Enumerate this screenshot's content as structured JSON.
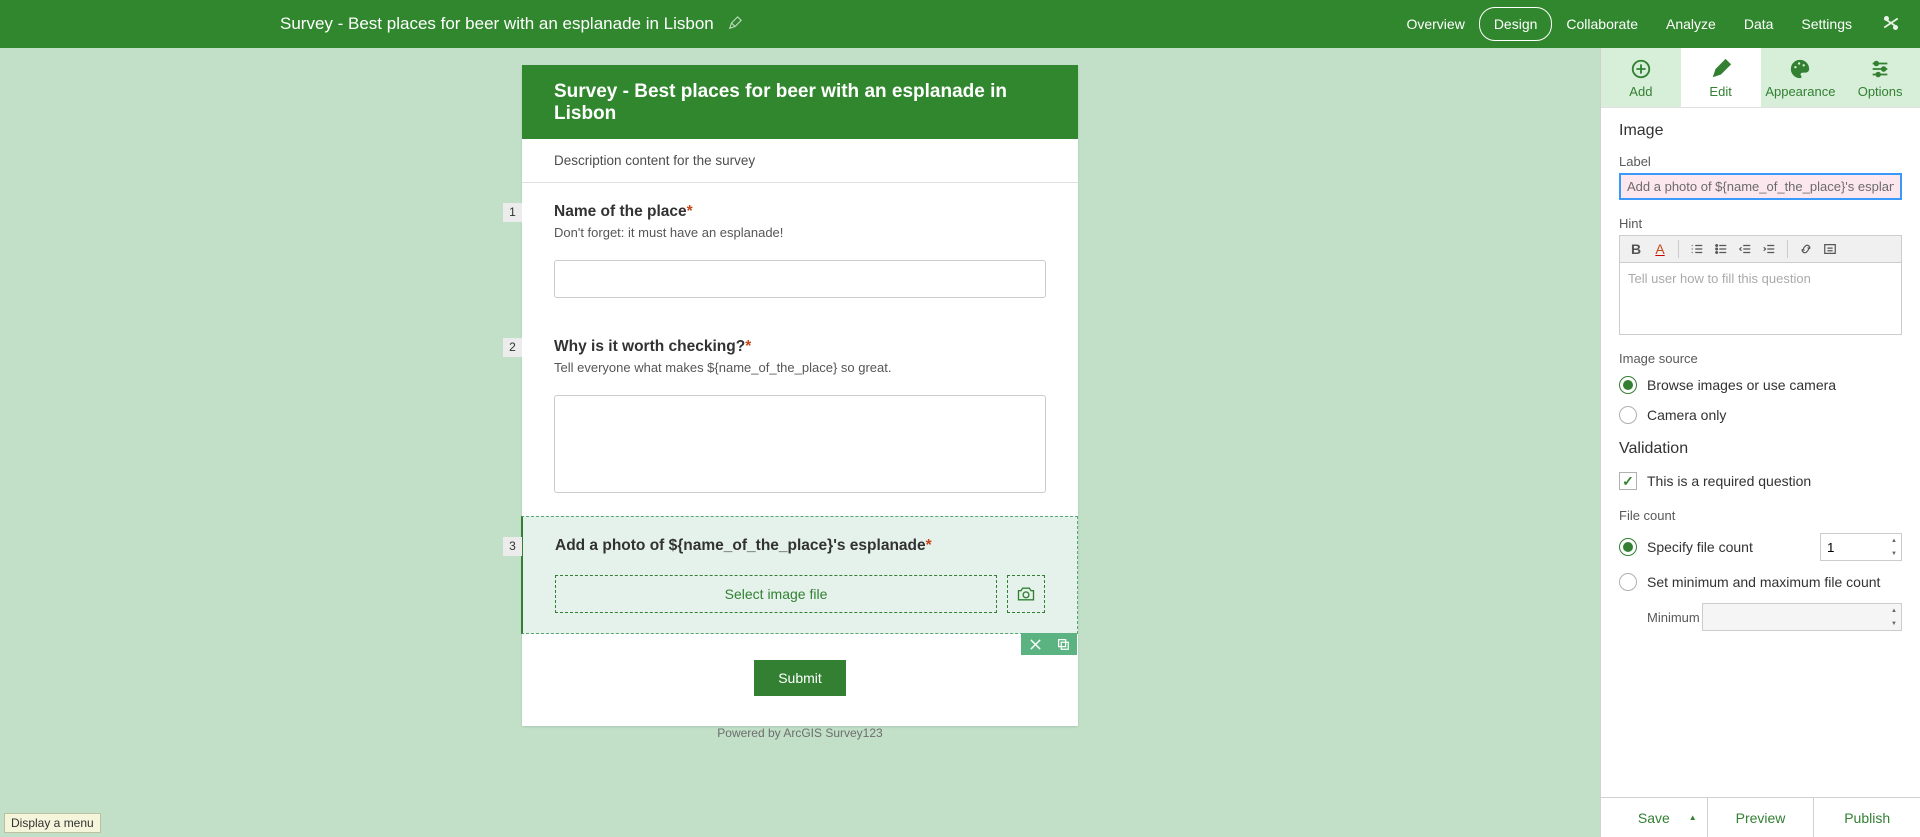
{
  "header": {
    "title": "Survey - Best places for beer with an esplanade in Lisbon",
    "nav": {
      "overview": "Overview",
      "design": "Design",
      "collaborate": "Collaborate",
      "analyze": "Analyze",
      "data": "Data",
      "settings": "Settings"
    }
  },
  "form": {
    "title": "Survey - Best places for beer with an esplanade in Lisbon",
    "description": "Description content for the survey",
    "q1": {
      "num": "1",
      "label": "Name of the place",
      "required": "*",
      "hint": "Don't forget: it must have an esplanade!"
    },
    "q2": {
      "num": "2",
      "label": "Why is it worth checking?",
      "required": "*",
      "hint": "Tell everyone what makes ${name_of_the_place} so great."
    },
    "q3": {
      "num": "3",
      "label": "Add a photo of ${name_of_the_place}'s esplanade",
      "required": "*",
      "select_file": "Select image file"
    },
    "submit": "Submit",
    "powered": "Powered by ArcGIS Survey123"
  },
  "panel": {
    "tabs": {
      "add": "Add",
      "edit": "Edit",
      "appearance": "Appearance",
      "options": "Options"
    },
    "section_image": "Image",
    "label_lbl": "Label",
    "label_value": "Add a photo of ${name_of_the_place}'s esplanade",
    "hint_lbl": "Hint",
    "hint_placeholder": "Tell user how to fill this question",
    "source_lbl": "Image source",
    "source_browse": "Browse images or use camera",
    "source_camera": "Camera only",
    "validation_lbl": "Validation",
    "required_lbl": "This is a required question",
    "filecount_lbl": "File count",
    "fc_specify": "Specify file count",
    "fc_value": "1",
    "fc_minmax": "Set minimum and maximum file count",
    "fc_min": "Minimum"
  },
  "actions": {
    "save": "Save",
    "preview": "Preview",
    "publish": "Publish"
  },
  "tooltip": "Display a menu"
}
